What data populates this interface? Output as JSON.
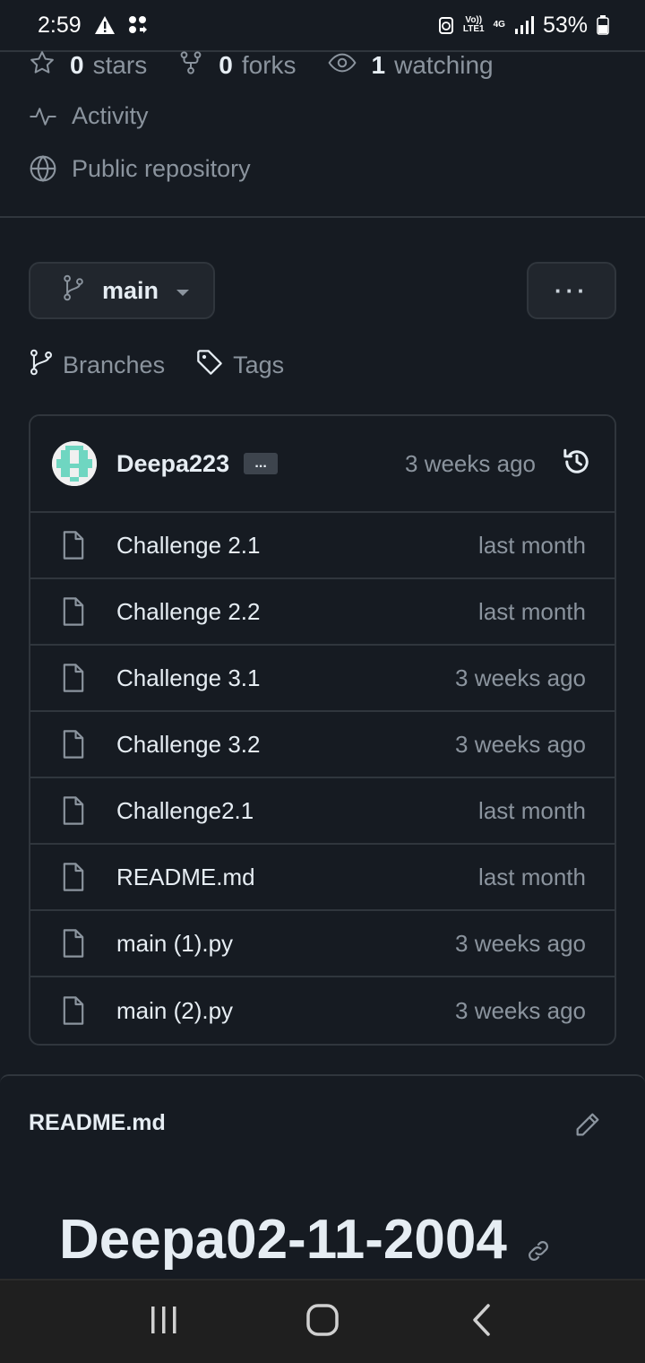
{
  "status_bar": {
    "time": "2:59",
    "battery": "53%",
    "network_top": "Vo))",
    "network_bottom": "LTE1",
    "net_type": "4G"
  },
  "repo": {
    "stars_count": "0",
    "stars_label": "stars",
    "forks_count": "0",
    "forks_label": "forks",
    "watching_count": "1",
    "watching_label": "watching",
    "activity_label": "Activity",
    "visibility_label": "Public repository"
  },
  "branch": {
    "current": "main",
    "more_label": "···",
    "branches_label": "Branches",
    "tags_label": "Tags"
  },
  "commit": {
    "author": "Deepa223",
    "ellipsis": "...",
    "time": "3 weeks ago"
  },
  "files": [
    {
      "name": "Challenge 2.1",
      "time": "last month"
    },
    {
      "name": "Challenge 2.2",
      "time": "last month"
    },
    {
      "name": "Challenge 3.1",
      "time": "3 weeks ago"
    },
    {
      "name": "Challenge 3.2",
      "time": "3 weeks ago"
    },
    {
      "name": "Challenge2.1",
      "time": "last month"
    },
    {
      "name": "README.md",
      "time": "last month"
    },
    {
      "name": "main (1).py",
      "time": "3 weeks ago"
    },
    {
      "name": "main (2).py",
      "time": "3 weeks ago"
    }
  ],
  "readme": {
    "filename": "README.md",
    "heading": "Deepa02-11-2004"
  },
  "colors": {
    "background": "#161b22",
    "border": "#30363d",
    "muted_text": "#8b949e",
    "primary_text": "#e6edf3"
  }
}
